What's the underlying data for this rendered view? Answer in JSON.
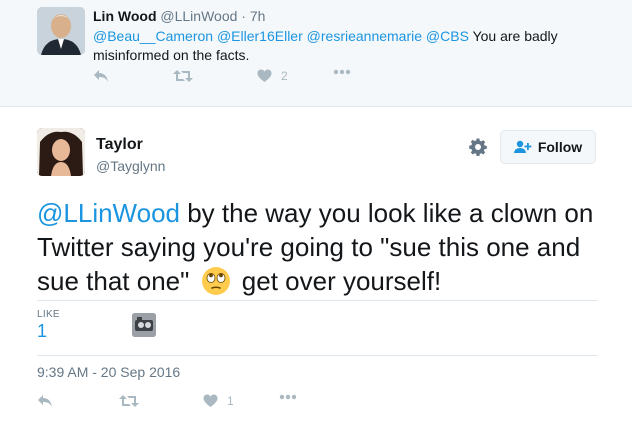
{
  "parent_tweet": {
    "name": "Lin Wood",
    "handle": "@LLinWood",
    "separator": "·",
    "time": "7h",
    "mentions": [
      "@Beau__Cameron",
      "@Eller16Eller",
      "@resrieannemarie",
      "@CBS"
    ],
    "text_rest": "You are badly",
    "text_line2": "misinformed on the facts.",
    "like_count": "2"
  },
  "main_tweet": {
    "name": "Taylor",
    "handle": "@Tayglynn",
    "follow_label": "Follow",
    "mention": "@LLinWood",
    "text_part1": " by the way you look like a clown on Twitter saying you're going to \"sue this one and sue that one\" ",
    "text_part2": " get over yourself!",
    "emoji": "face-with-rolling-eyes",
    "likes_label": "LIKE",
    "likes_count": "1",
    "timestamp": "9:39 AM - 20 Sep 2016",
    "footer_like_count": "1"
  },
  "colors": {
    "link": "#1b95e0",
    "muted": "#657786",
    "icon": "#aab8c2",
    "parent_bg": "#f5f8fa"
  }
}
